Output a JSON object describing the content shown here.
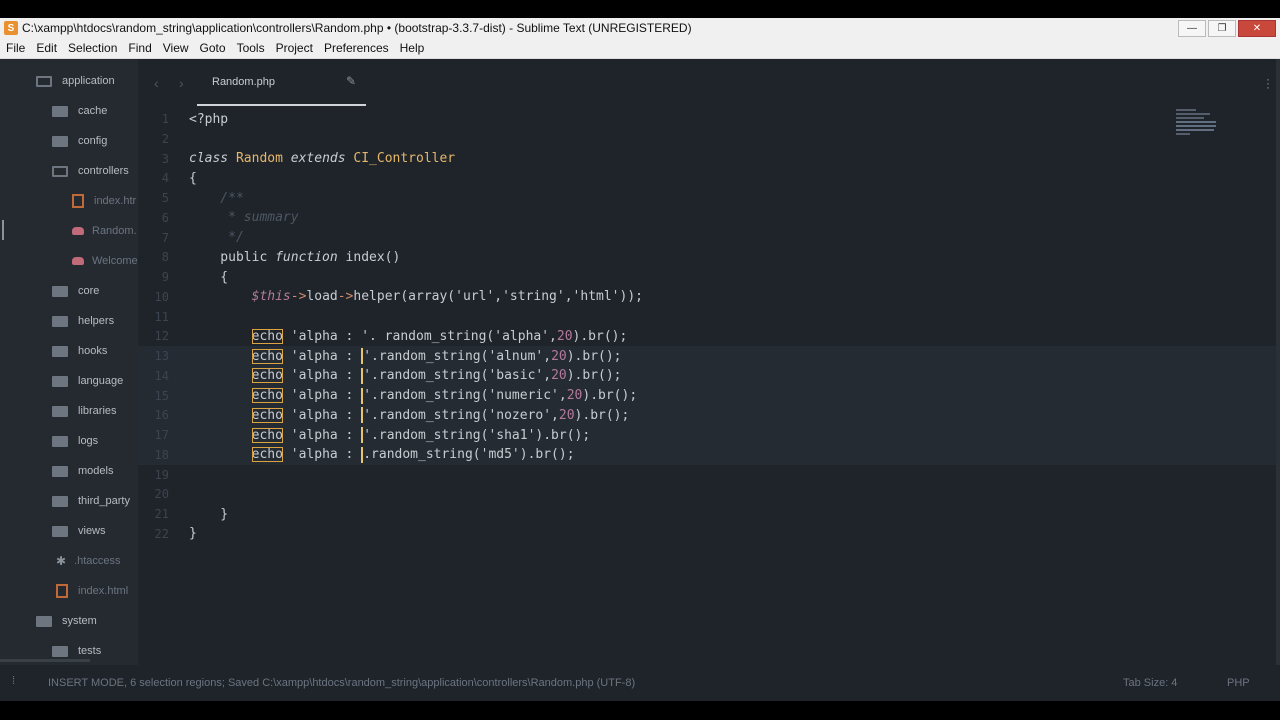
{
  "window": {
    "title": "C:\\xampp\\htdocs\\random_string\\application\\controllers\\Random.php • (bootstrap-3.3.7-dist) - Sublime Text (UNREGISTERED)",
    "app_icon_letter": "S",
    "buttons": {
      "minimize": "—",
      "maximize": "❐",
      "close": "✕"
    }
  },
  "menu": [
    "File",
    "Edit",
    "Selection",
    "Find",
    "View",
    "Goto",
    "Tools",
    "Project",
    "Preferences",
    "Help"
  ],
  "sidebar": {
    "items": [
      {
        "label": "application",
        "type": "folder-open"
      },
      {
        "label": "cache",
        "type": "folder"
      },
      {
        "label": "config",
        "type": "folder"
      },
      {
        "label": "controllers",
        "type": "folder-open"
      },
      {
        "label": "index.htr",
        "type": "html-file"
      },
      {
        "label": "Random.",
        "type": "php-file"
      },
      {
        "label": "Welcome",
        "type": "php-file"
      },
      {
        "label": "core",
        "type": "folder"
      },
      {
        "label": "helpers",
        "type": "folder"
      },
      {
        "label": "hooks",
        "type": "folder"
      },
      {
        "label": "language",
        "type": "folder"
      },
      {
        "label": "libraries",
        "type": "folder"
      },
      {
        "label": "logs",
        "type": "folder"
      },
      {
        "label": "models",
        "type": "folder"
      },
      {
        "label": "third_party",
        "type": "folder"
      },
      {
        "label": "views",
        "type": "folder"
      },
      {
        "label": ".htaccess",
        "type": "config-file"
      },
      {
        "label": "index.html",
        "type": "html-file"
      },
      {
        "label": "system",
        "type": "folder"
      },
      {
        "label": "tests",
        "type": "folder"
      }
    ]
  },
  "tab": {
    "label": "Random.php"
  },
  "code": {
    "lines": [
      {
        "n": "1",
        "parts": [
          [
            "t-pl",
            "<?php"
          ]
        ]
      },
      {
        "n": "2",
        "parts": []
      },
      {
        "n": "3",
        "parts": [
          [
            "t-it",
            "class"
          ],
          [
            "t-pl",
            " "
          ],
          [
            "t-cls",
            "Random"
          ],
          [
            "t-pl",
            " "
          ],
          [
            "t-it",
            "extends"
          ],
          [
            "t-pl",
            " "
          ],
          [
            "t-cls",
            "CI_Controller"
          ]
        ]
      },
      {
        "n": "4",
        "parts": [
          [
            "t-pl",
            "{"
          ]
        ]
      },
      {
        "n": "5",
        "parts": [
          [
            "t-cm",
            "    /**"
          ]
        ]
      },
      {
        "n": "6",
        "parts": [
          [
            "t-cm",
            "     * summary"
          ]
        ]
      },
      {
        "n": "7",
        "parts": [
          [
            "t-cm",
            "     */"
          ]
        ]
      },
      {
        "n": "8",
        "parts": [
          [
            "t-pl",
            "    public "
          ],
          [
            "t-it",
            "function"
          ],
          [
            "t-pl",
            " index()"
          ]
        ]
      },
      {
        "n": "9",
        "parts": [
          [
            "t-pl",
            "    {"
          ]
        ]
      },
      {
        "n": "10",
        "parts": [
          [
            "t-pl",
            "        "
          ],
          [
            "t-var",
            "$this"
          ],
          [
            "t-op",
            "->"
          ],
          [
            "t-pl",
            "load"
          ],
          [
            "t-op",
            "->"
          ],
          [
            "t-pl",
            "helper(array('url','string','html'));"
          ]
        ]
      },
      {
        "n": "11",
        "parts": []
      },
      {
        "n": "12",
        "parts": [
          [
            "t-pl",
            "        "
          ],
          [
            "sel",
            "echo"
          ],
          [
            "t-pl",
            " 'alpha : '. random_string('alpha',"
          ],
          [
            "t-num",
            "20"
          ],
          [
            "t-pl",
            ").br();"
          ]
        ]
      },
      {
        "n": "13",
        "parts": [
          [
            "t-pl",
            "        "
          ],
          [
            "sel",
            "echo"
          ],
          [
            "t-pl",
            " 'alpha : "
          ],
          [
            "caret",
            ""
          ],
          [
            "t-pl",
            "'.random_string('alnum',"
          ],
          [
            "t-num",
            "20"
          ],
          [
            "t-pl",
            ").br();"
          ]
        ]
      },
      {
        "n": "14",
        "parts": [
          [
            "t-pl",
            "        "
          ],
          [
            "sel",
            "echo"
          ],
          [
            "t-pl",
            " 'alpha : "
          ],
          [
            "caret",
            ""
          ],
          [
            "t-pl",
            "'.random_string('basic',"
          ],
          [
            "t-num",
            "20"
          ],
          [
            "t-pl",
            ").br();"
          ]
        ]
      },
      {
        "n": "15",
        "parts": [
          [
            "t-pl",
            "        "
          ],
          [
            "sel",
            "echo"
          ],
          [
            "t-pl",
            " 'alpha : "
          ],
          [
            "caret",
            ""
          ],
          [
            "t-pl",
            "'.random_string('numeric',"
          ],
          [
            "t-num",
            "20"
          ],
          [
            "t-pl",
            ").br();"
          ]
        ]
      },
      {
        "n": "16",
        "parts": [
          [
            "t-pl",
            "        "
          ],
          [
            "sel",
            "echo"
          ],
          [
            "t-pl",
            " 'alpha : "
          ],
          [
            "caret",
            ""
          ],
          [
            "t-pl",
            "'.random_string('nozero',"
          ],
          [
            "t-num",
            "20"
          ],
          [
            "t-pl",
            ").br();"
          ]
        ]
      },
      {
        "n": "17",
        "parts": [
          [
            "t-pl",
            "        "
          ],
          [
            "sel",
            "echo"
          ],
          [
            "t-pl",
            " 'alpha : "
          ],
          [
            "caret",
            ""
          ],
          [
            "t-pl",
            "'.random_string('sha1').br();"
          ]
        ]
      },
      {
        "n": "18",
        "parts": [
          [
            "t-pl",
            "        "
          ],
          [
            "sel",
            "echo"
          ],
          [
            "t-pl",
            " 'alpha : "
          ],
          [
            "caret",
            ""
          ],
          [
            "t-pl",
            ".random_string('md5').br();"
          ]
        ]
      },
      {
        "n": "19",
        "parts": []
      },
      {
        "n": "20",
        "parts": []
      },
      {
        "n": "21",
        "parts": [
          [
            "t-pl",
            "    }"
          ]
        ]
      },
      {
        "n": "22",
        "parts": [
          [
            "t-pl",
            "}"
          ]
        ]
      }
    ]
  },
  "status": {
    "message": "INSERT MODE, 6 selection regions; Saved C:\\xampp\\htdocs\\random_string\\application\\controllers\\Random.php (UTF-8)",
    "tab_size": "Tab Size: 4",
    "syntax": "PHP"
  }
}
